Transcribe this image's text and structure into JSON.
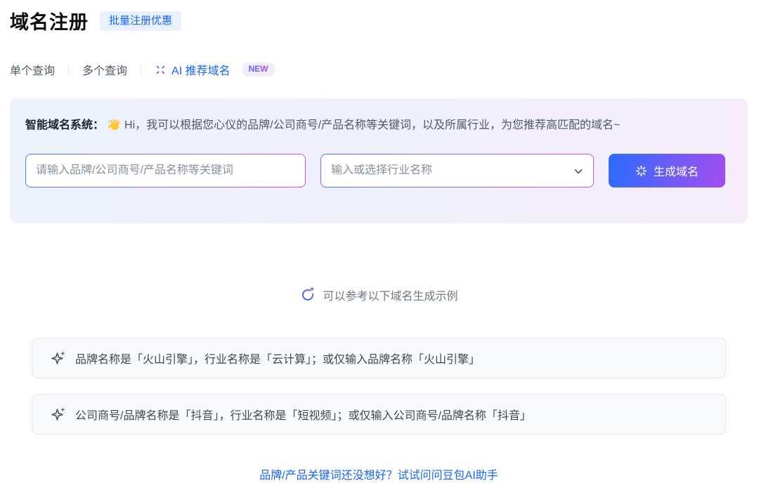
{
  "header": {
    "title": "域名注册",
    "badge": "批量注册优惠"
  },
  "tabs": {
    "single": "单个查询",
    "multiple": "多个查询",
    "ai": "AI 推荐域名",
    "ai_badge": "NEW"
  },
  "assistant": {
    "label": "智能域名系统：",
    "greeting": "Hi，我可以根据您心仪的品牌/公司商号/产品名称等关键词，以及所属行业，为您推荐高匹配的域名~",
    "keyword_placeholder": "请输入品牌/公司商号/产品名称等关键词",
    "industry_placeholder": "输入或选择行业名称",
    "generate_label": "生成域名"
  },
  "examples": {
    "hint": "可以参考以下域名生成示例",
    "items": [
      "品牌名称是「火山引擎」，行业名称是「云计算」；或仅输入品牌名称「火山引擎」",
      "公司商号/品牌名称是「抖音」，行业名称是「短视频」；或仅输入公司商号/品牌名称「抖音」"
    ]
  },
  "footer": {
    "link": "品牌/产品关键词还没想好？试试问问豆包AI助手"
  },
  "icons": {
    "ai_tab": "sparkle-burst-icon",
    "generate_button": "sparkle-burst-icon",
    "hint": "lightbulb-spark-icon",
    "example_item": "four-point-star-icon",
    "industry_select": "chevron-down-icon",
    "greeting": "waving-hand-icon"
  },
  "colors": {
    "primary_blue": "#1664ff",
    "badge_bg": "#e8f1ff",
    "new_badge_bg": "#f1edfc",
    "card_gradient_start": "#edf2fc",
    "card_gradient_end": "#f5eefa",
    "input_border_start": "#4c7dff",
    "input_border_end": "#cb52e8",
    "button_gradient_start": "#2a6cff",
    "button_gradient_end": "#a24ded",
    "placeholder_gray": "#86909c",
    "text_dark": "#1d2129",
    "text_gray": "#4e5969",
    "example_card_bg": "#f8f9fb",
    "example_card_border": "#e7e8ec"
  }
}
